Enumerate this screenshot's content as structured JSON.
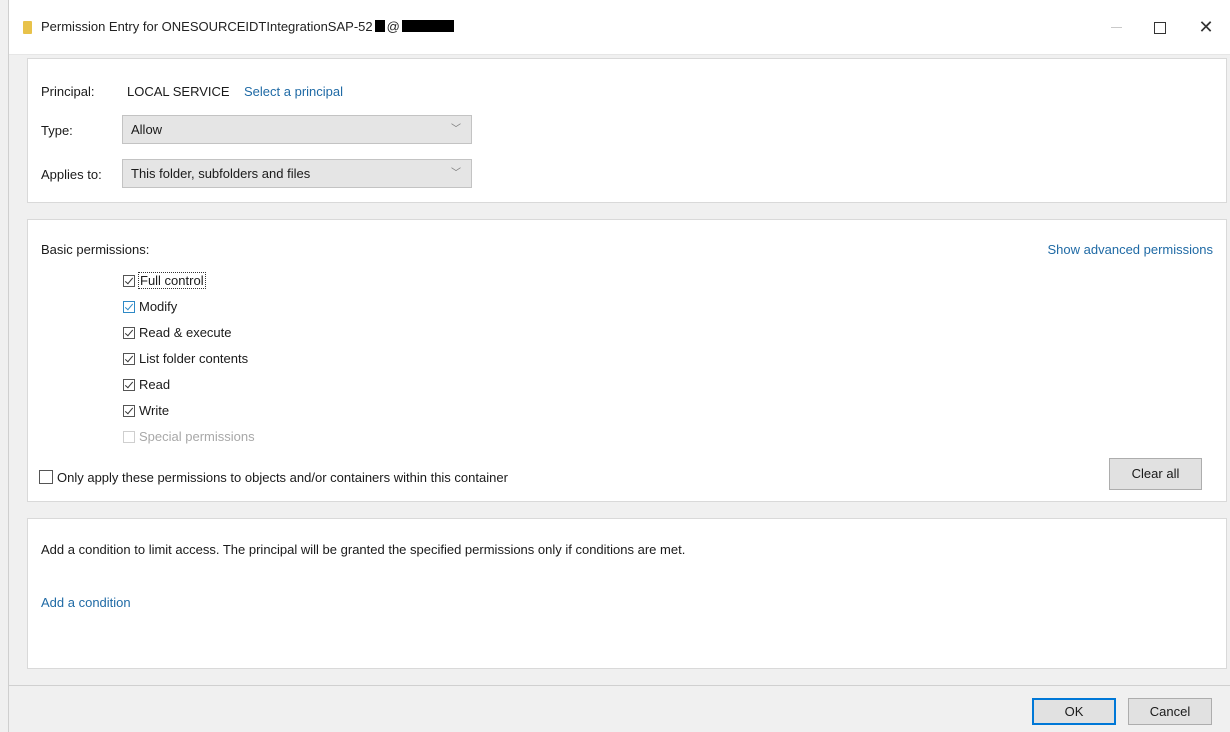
{
  "window": {
    "title_prefix": "Permission Entry for ONESOURCEIDTIntegrationSAP-52",
    "title_mid": "@",
    "close_glyph": "✕"
  },
  "principal": {
    "label": "Principal:",
    "value": "LOCAL SERVICE",
    "link": "Select a principal"
  },
  "type": {
    "label": "Type:",
    "value": "Allow"
  },
  "applies_to": {
    "label": "Applies to:",
    "value": "This folder, subfolders and files"
  },
  "basic_permissions": {
    "label": "Basic permissions:",
    "advanced_link": "Show advanced permissions",
    "items": [
      {
        "label": "Full control",
        "checked": true
      },
      {
        "label": "Modify",
        "checked": true
      },
      {
        "label": "Read & execute",
        "checked": true
      },
      {
        "label": "List folder contents",
        "checked": true
      },
      {
        "label": "Read",
        "checked": true
      },
      {
        "label": "Write",
        "checked": true
      },
      {
        "label": "Special permissions",
        "checked": false,
        "disabled": true
      }
    ],
    "only_apply": "Only apply these permissions to objects and/or containers within this container",
    "clear_all": "Clear all"
  },
  "condition": {
    "text": "Add a condition to limit access. The principal will be granted the specified permissions only if conditions are met.",
    "link": "Add a condition"
  },
  "buttons": {
    "ok": "OK",
    "cancel": "Cancel"
  }
}
